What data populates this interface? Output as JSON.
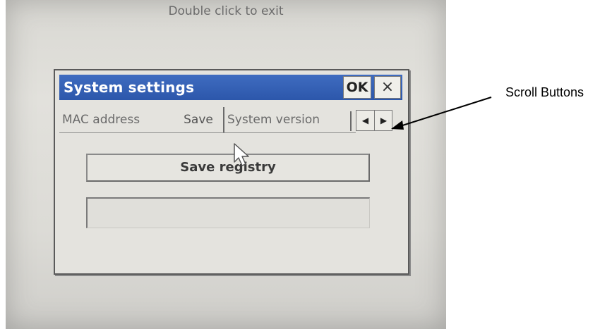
{
  "screen": {
    "exit_hint": "Double click to exit"
  },
  "dialog": {
    "title": "System settings",
    "ok_label": "OK",
    "close_label": "×"
  },
  "tabs": [
    {
      "label": "MAC address"
    },
    {
      "label": "Save",
      "active": true
    },
    {
      "label": "System version"
    }
  ],
  "scroll_buttons": {
    "left_icon": "arrow-left-icon",
    "right_icon": "arrow-right-icon"
  },
  "save_panel": {
    "button_label": "Save registry",
    "status_text": ""
  },
  "annotation": {
    "label": "Scroll Buttons"
  },
  "colors": {
    "titlebar": "#2c57ab",
    "title_text": "#ffffff",
    "dialog_bg": "#e4e3de"
  }
}
